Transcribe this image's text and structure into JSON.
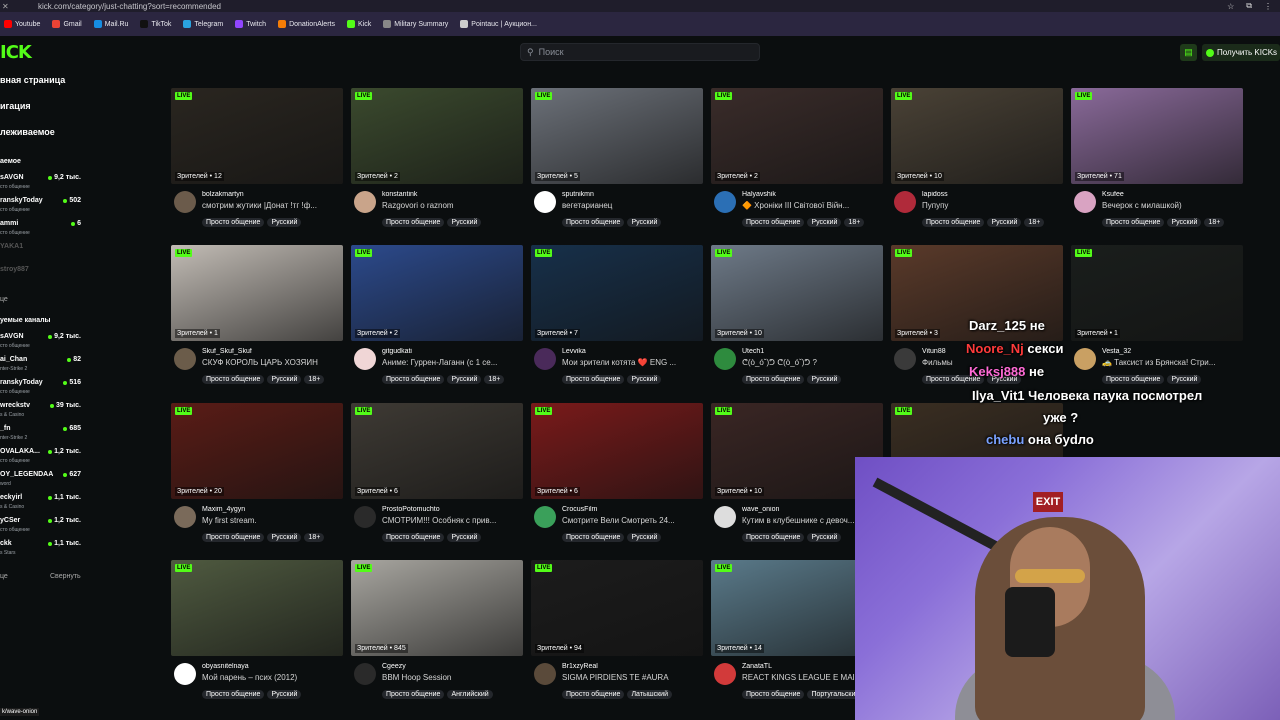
{
  "browser": {
    "url": "kick.com/category/just-chatting?sort=recommended",
    "bookmarks": [
      {
        "label": "Youtube",
        "icon": "youtube-icon",
        "color": "#ff0000"
      },
      {
        "label": "Gmail",
        "icon": "gmail-icon",
        "color": "#ea4335"
      },
      {
        "label": "Mail.Ru",
        "icon": "mailru-icon",
        "color": "#168de2"
      },
      {
        "label": "TikTok",
        "icon": "tiktok-icon",
        "color": "#111111"
      },
      {
        "label": "Telegram",
        "icon": "telegram-icon",
        "color": "#2aa3df"
      },
      {
        "label": "Twitch",
        "icon": "twitch-icon",
        "color": "#9146ff"
      },
      {
        "label": "DonationAlerts",
        "icon": "donationalerts-icon",
        "color": "#f57d07"
      },
      {
        "label": "Kick",
        "icon": "kick-icon",
        "color": "#53fc18"
      },
      {
        "label": "Military Summary",
        "icon": "military-icon",
        "color": "#888888"
      },
      {
        "label": "Pointauc | Аукцион...",
        "icon": "pointauc-icon",
        "color": "#cccccc"
      }
    ]
  },
  "header": {
    "logo": "ICK",
    "search_placeholder": "Поиск",
    "kicks_button": "Получить KICKs"
  },
  "sidebar": {
    "nav": [
      "вная страница",
      "игация",
      "леживаемое"
    ],
    "followed_title": "аемое",
    "followed": [
      {
        "name": "sAVGN",
        "sub": "сто общение",
        "viewers": "9,2 тыс."
      },
      {
        "name": "ranskyToday",
        "sub": "сто общение",
        "viewers": "502"
      },
      {
        "name": "ammi",
        "sub": "сто общение",
        "viewers": "6"
      },
      {
        "name": "YAKA1",
        "sub": "",
        "viewers": ""
      },
      {
        "name": "stroy887",
        "sub": "",
        "viewers": ""
      }
    ],
    "more": "це",
    "rec_title": "уемые каналы",
    "recommended": [
      {
        "name": "sAVGN",
        "sub": "сто общение",
        "viewers": "9,2 тыс."
      },
      {
        "name": "ai_Chan",
        "sub": "nter-Strike 2",
        "viewers": "82"
      },
      {
        "name": "ranskyToday",
        "sub": "сто общение",
        "viewers": "516"
      },
      {
        "name": "wreckstv",
        "sub": "s & Casino",
        "viewers": "39 тыс."
      },
      {
        "name": "_fn",
        "sub": "nter-Strike 2",
        "viewers": "685"
      },
      {
        "name": "OVALAKA...",
        "sub": "сто общение",
        "viewers": "1,2 тыс."
      },
      {
        "name": "OY_LEGENDAA",
        "sub": "word",
        "viewers": "627"
      },
      {
        "name": "eckyirl",
        "sub": "s & Casino",
        "viewers": "1,1 тыс."
      },
      {
        "name": "yCSer",
        "sub": "сто общение",
        "viewers": "1,2 тыс."
      },
      {
        "name": "ckk",
        "sub": "s Stars",
        "viewers": "1,1 тыс."
      }
    ],
    "more2": "це",
    "collapse": "Свернуть"
  },
  "grid": [
    {
      "live": "LIVE",
      "viewers": "Зрителей • 12",
      "user": "bolzakmartyn",
      "title": "смотрим жутики |Донат !тг !ф...",
      "tags": [
        "Просто общение",
        "Русский"
      ],
      "thumb": "#2a2620",
      "avatar": "#6b5b4b"
    },
    {
      "live": "LIVE",
      "viewers": "Зрителей • 2",
      "user": "konstantink",
      "title": "Razgovori o raznom",
      "tags": [
        "Просто общение",
        "Русский"
      ],
      "thumb": "#3b4a2e",
      "avatar": "#c9a48a"
    },
    {
      "live": "LIVE",
      "viewers": "Зрителей • 5",
      "user": "sputnikmn",
      "title": "вегетарианец",
      "tags": [
        "Просто общение",
        "Русский"
      ],
      "thumb": "#6c7179",
      "avatar": "#ffffff"
    },
    {
      "live": "LIVE",
      "viewers": "Зрителей • 2",
      "user": "Halyavshik",
      "title": "🔶 Хроніки III Світової Війн...",
      "tags": [
        "Просто общение",
        "Русский",
        "18+"
      ],
      "thumb": "#3a2c2a",
      "avatar": "#2b6fb5"
    },
    {
      "live": "LIVE",
      "viewers": "Зрителей • 10",
      "user": "lapidoss",
      "title": "Пупупу",
      "tags": [
        "Просто общение",
        "Русский",
        "18+"
      ],
      "thumb": "#4a4236",
      "avatar": "#b02a3a"
    },
    {
      "live": "LIVE",
      "viewers": "Зрителей • 71",
      "user": "Ksufee",
      "title": "Вечерок с милашкой)",
      "tags": [
        "Просто общение",
        "Русский",
        "18+"
      ],
      "thumb": "#8a6a9a",
      "avatar": "#d9a3c2"
    },
    {
      "live": "LIVE",
      "viewers": "Зрителей • 1",
      "user": "Skuf_Skuf_Skuf",
      "title": "СКУФ КОРОЛЬ ЦАРЬ ХОЗЯИН",
      "tags": [
        "Просто общение",
        "Русский",
        "18+"
      ],
      "thumb": "#c2bcb5",
      "avatar": "#6b5c4a"
    },
    {
      "live": "LIVE",
      "viewers": "Зрителей • 2",
      "user": "gitgudkati",
      "title": "Аниме: Гуррен-Лаганн (с 1 се...",
      "tags": [
        "Просто общение",
        "Русский",
        "18+"
      ],
      "thumb": "#2c4a8c",
      "avatar": "#f0d6d6"
    },
    {
      "live": "LIVE",
      "viewers": "Зрителей • 7",
      "user": "Levvika",
      "title": "Мои зрители котята ❤️ ENG ...",
      "tags": [
        "Просто общение",
        "Русский"
      ],
      "thumb": "#17304a",
      "avatar": "#4a2a5a"
    },
    {
      "live": "LIVE",
      "viewers": "Зрителей • 10",
      "user": "Utech1",
      "title": "ᕦ(ò_óˇ)ᕤ ᕦ(ò_óˇ)ᕤ ?",
      "tags": [
        "Просто общение",
        "Русский"
      ],
      "thumb": "#6e7a88",
      "avatar": "#2e8b3e"
    },
    {
      "live": "LIVE",
      "viewers": "Зрителей • 3",
      "user": "Vitun88",
      "title": "Фильмы",
      "tags": [
        "Просто общение",
        "Русский"
      ],
      "thumb": "#5a3a2a",
      "avatar": "#3a3a3a"
    },
    {
      "live": "LIVE",
      "viewers": "Зрителей • 1",
      "user": "Vesta_32",
      "title": "🚕 Таксист из Брянска! Стри...",
      "tags": [
        "Просто общение",
        "Русский"
      ],
      "thumb": "#1a1e1c",
      "avatar": "#c9a063"
    },
    {
      "live": "LIVE",
      "viewers": "Зрителей • 20",
      "user": "Maxim_4ygyn",
      "title": "My first stream.",
      "tags": [
        "Просто общение",
        "Русский",
        "18+"
      ],
      "thumb": "#5a1c16",
      "avatar": "#7a6a5a"
    },
    {
      "live": "LIVE",
      "viewers": "Зрителей • 6",
      "user": "ProstoPotomuchto",
      "title": "СМОТРИМ!!! Особняк с прив...",
      "tags": [
        "Просто общение",
        "Русский"
      ],
      "thumb": "#3e3a34",
      "avatar": "#2a2a2a"
    },
    {
      "live": "LIVE",
      "viewers": "Зрителей • 6",
      "user": "CrocusFilm",
      "title": "Смотрите Вели Смотреть 24...",
      "tags": [
        "Просто общение",
        "Русский"
      ],
      "thumb": "#7a1a1a",
      "avatar": "#3aa05a"
    },
    {
      "live": "LIVE",
      "viewers": "Зрителей • 10",
      "user": "wave_onion",
      "title": "Кутим в клубешнике с девоч...",
      "tags": [
        "Просто общение",
        "Русский"
      ],
      "thumb": "#3a2624",
      "avatar": "#dddddd"
    },
    {
      "live": "LIVE",
      "viewers": "",
      "user": "",
      "title": "",
      "tags": [],
      "thumb": "#3a2e22",
      "avatar": ""
    },
    {
      "live": "",
      "viewers": "",
      "user": "",
      "title": "",
      "tags": [],
      "thumb": "",
      "avatar": ""
    },
    {
      "live": "LIVE",
      "viewers": "",
      "user": "obyasnitelnaya",
      "title": "Мой парень – псих (2012)",
      "tags": [
        "Просто общение",
        "Русский"
      ],
      "thumb": "#4f5a40",
      "avatar": "#ffffff"
    },
    {
      "live": "LIVE",
      "viewers": "Зрителей • 845",
      "user": "Cgeezy",
      "title": "BBM Hoop Session",
      "tags": [
        "Просто общение",
        "Английский"
      ],
      "thumb": "#a8a6a0",
      "avatar": "#2a2a2a"
    },
    {
      "live": "LIVE",
      "viewers": "Зрителей • 94",
      "user": "Br1xzyReal",
      "title": "SIGMA PIRDIENS TE #AURA",
      "tags": [
        "Просто общение",
        "Латышский"
      ],
      "thumb": "#1c1c1c",
      "avatar": "#5a4a3a"
    },
    {
      "live": "LIVE",
      "viewers": "Зрителей • 14",
      "user": "ZanataTL",
      "title": "REACT KINGS LEAGUE E MAIS",
      "tags": [
        "Просто общение",
        "Португальский"
      ],
      "thumb": "#5a7a8a",
      "avatar": "#d23a3a"
    }
  ],
  "overlay_chat": [
    {
      "user": "Darz_125",
      "text": "не",
      "color": "#ffffff"
    },
    {
      "user": "Noore_Nj",
      "text": "секси",
      "color": "#ff3b3b"
    },
    {
      "user": "Keksj888",
      "text": "не",
      "color": "#ff6bd6"
    },
    {
      "user": "Ilya_Vit1",
      "text": "Человека паука посмотрел",
      "color": "#ffffff"
    },
    {
      "user": "",
      "text": "уже ?",
      "color": "#ffffff"
    },
    {
      "user": "chebu",
      "text": "она бydло",
      "color": "#7aa2ff"
    }
  ],
  "status_url": "k/wave-onion"
}
